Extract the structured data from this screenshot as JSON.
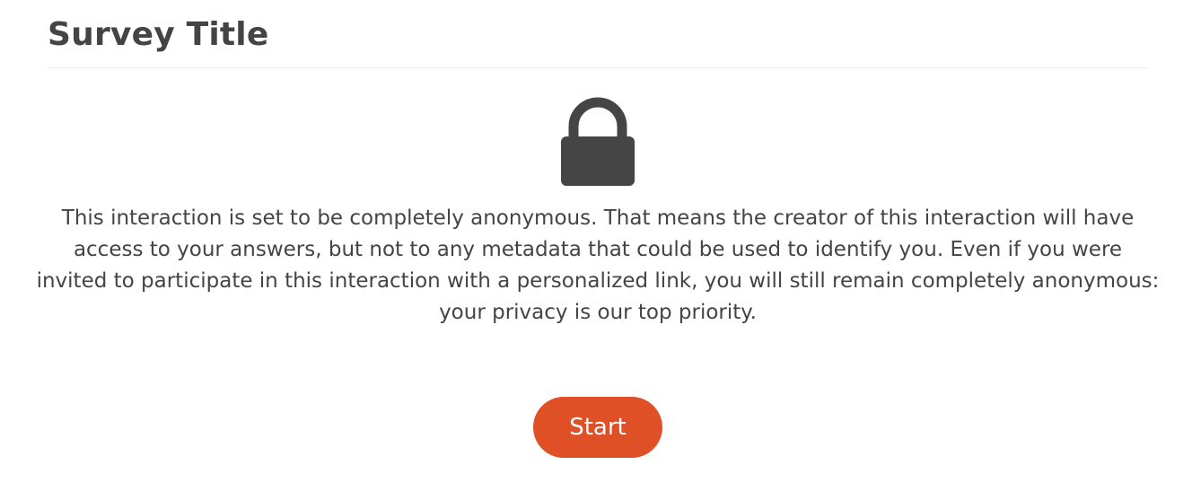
{
  "header": {
    "title": "Survey Title"
  },
  "privacy": {
    "icon": "lock-icon",
    "message": "This interaction is set to be completely anonymous. That means the creator of this interaction will have access to your answers, but not to any metadata that could be used to identify you. Even if you were invited to participate in this interaction with a personalized link, you will still remain completely anonymous: your privacy is our top priority."
  },
  "actions": {
    "start_label": "Start"
  },
  "colors": {
    "accent": "#df5026",
    "text": "#444444",
    "icon": "#454545",
    "divider": "#eeeeee"
  }
}
